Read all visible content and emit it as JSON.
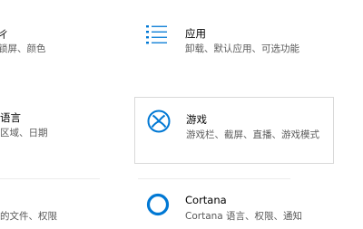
{
  "accent_color": "#0078d4",
  "tiles": [
    {
      "title": "ㄔ",
      "desc": "锁屏、颜色",
      "icon": "personalization-icon"
    },
    {
      "title": "应用",
      "desc": "卸载、默认应用、可选功能",
      "icon": "apps-list-icon"
    },
    {
      "title": "语言",
      "desc": "区域、日期",
      "icon": "time-language-icon"
    },
    {
      "title": "游戏",
      "desc": "游戏栏、截屏、直播、游戏模式",
      "icon": "xbox-icon"
    },
    {
      "title": "",
      "desc": "的文件、权限",
      "icon": "search-icon"
    },
    {
      "title": "Cortana",
      "desc": "Cortana 语言、权限、通知",
      "icon": "cortana-icon"
    }
  ]
}
